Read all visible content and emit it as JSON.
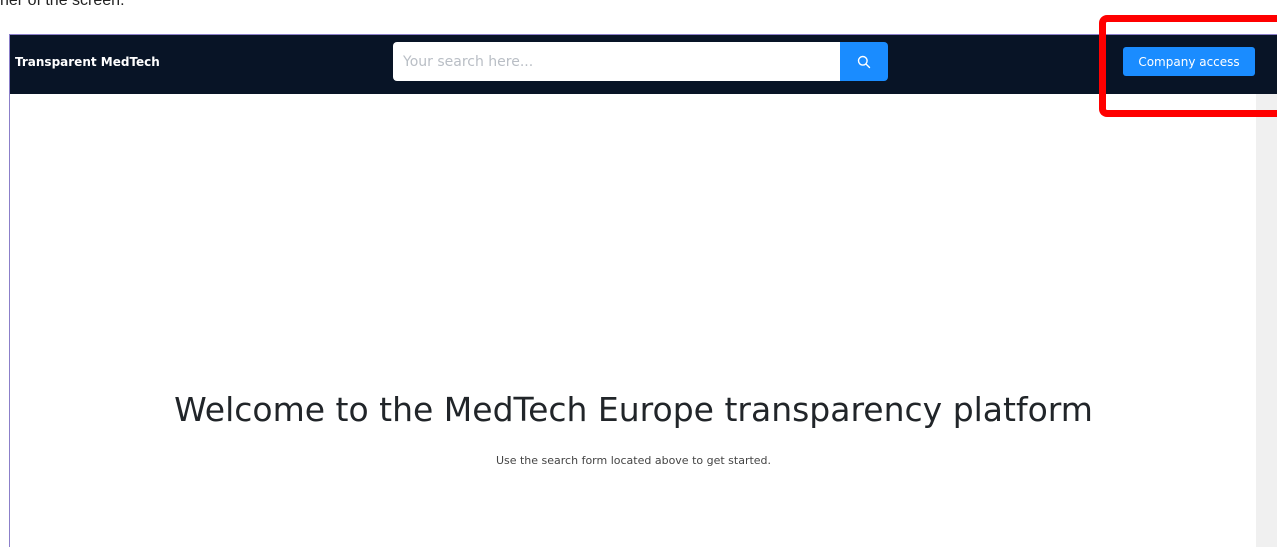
{
  "caption": "ner of the screen.",
  "navbar": {
    "brand": "Transparent MedTech",
    "search": {
      "placeholder": "Your search here...",
      "icon": "search-icon"
    },
    "company_access_label": "Company access"
  },
  "hero": {
    "title": "Welcome to the MedTech Europe transparency platform",
    "subtitle": "Use the search form located above to get started."
  },
  "annotation": {
    "color": "#ff0000"
  },
  "colors": {
    "navbar_bg": "#081426",
    "accent": "#1a8cff"
  }
}
